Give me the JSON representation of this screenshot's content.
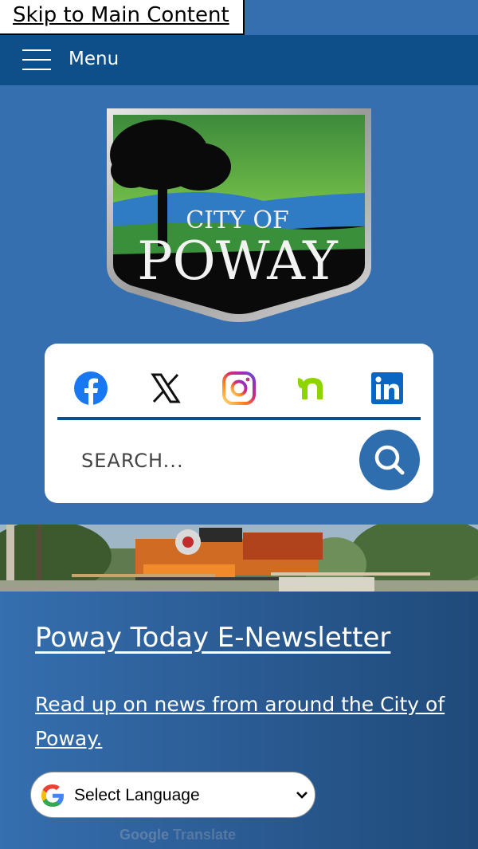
{
  "skip_link": "Skip to Main Content",
  "menu": {
    "label": "Menu"
  },
  "logo": {
    "line1": "CITY OF",
    "line2": "POWAY"
  },
  "social": [
    "facebook-icon",
    "x-icon",
    "instagram-icon",
    "nextdoor-icon",
    "linkedin-icon"
  ],
  "search": {
    "placeholder": "SEARCH..."
  },
  "promo": {
    "title": "Poway Today E-Newsletter",
    "text": "Read up on news from around the City of Poway."
  },
  "translate": {
    "select_label": "Select Language",
    "powered_google": "Google",
    "powered_translate": "Translate"
  },
  "colors": {
    "primary": "#356faf",
    "navbar": "#0f4f89",
    "accent": "#2f6eae"
  }
}
